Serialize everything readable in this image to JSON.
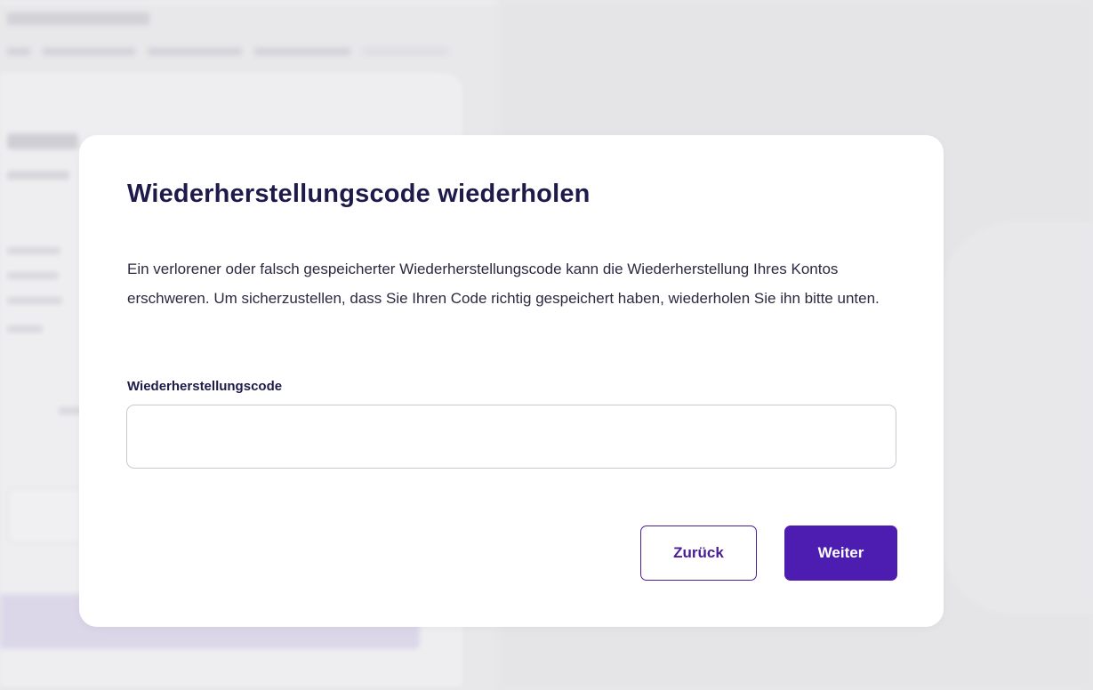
{
  "modal": {
    "title": "Wiederherstellungscode wiederholen",
    "description": "Ein verlorener oder falsch gespeicherter Wiederherstellungscode kann die Wiederherstellung Ihres Kontos erschweren. Um sicherzustellen, dass Sie Ihren Code richtig gespeichert haben, wiederholen Sie ihn bitte unten.",
    "field_label": "Wiederherstellungscode",
    "field_value": "",
    "field_placeholder": "",
    "back_label": "Zurück",
    "next_label": "Weiter"
  },
  "colors": {
    "title": "#1e1b4b",
    "primary": "#4c1db0",
    "back_border": "#4c1d95",
    "overlay_background": "#ebebed"
  }
}
